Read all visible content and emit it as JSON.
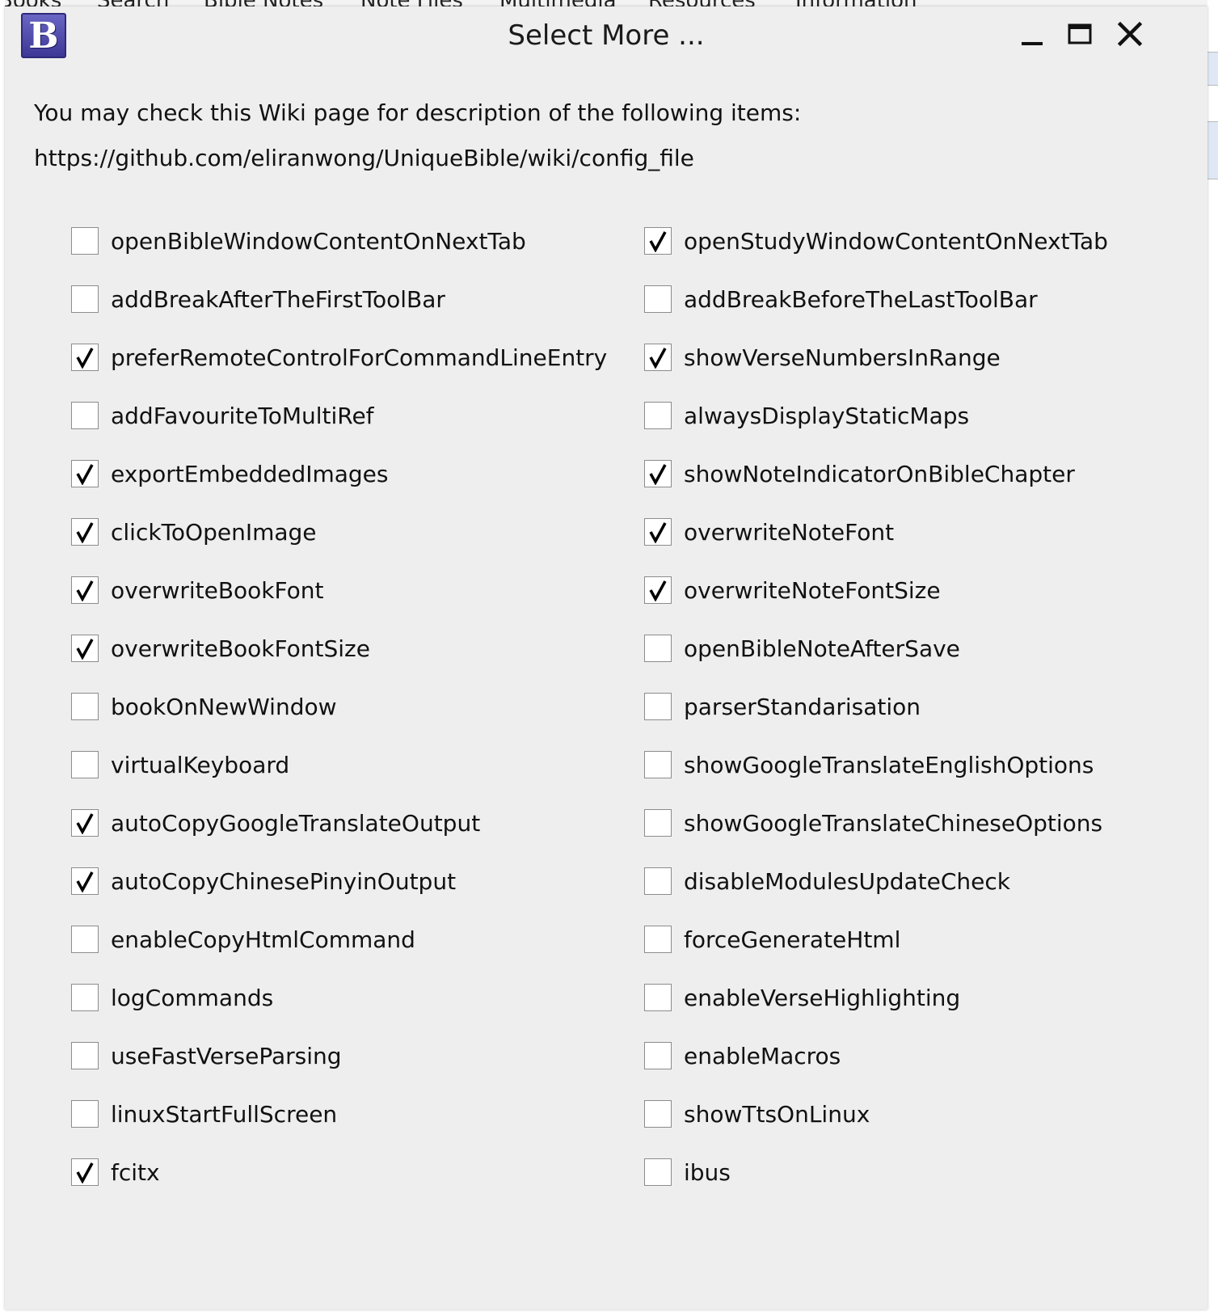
{
  "background": {
    "menu": [
      "Books",
      "Search",
      "Bible Notes",
      "Note Files",
      "Multimedia",
      "Resources",
      "Information"
    ]
  },
  "dialog": {
    "title": "Select More ...",
    "intro_line1": "You may check this Wiki page for description of the following items:",
    "intro_line2": "https://github.com/eliranwong/UniqueBible/wiki/config_file",
    "options_left": [
      {
        "label": "openBibleWindowContentOnNextTab",
        "checked": false
      },
      {
        "label": "addBreakAfterTheFirstToolBar",
        "checked": false
      },
      {
        "label": "preferRemoteControlForCommandLineEntry",
        "checked": true
      },
      {
        "label": "addFavouriteToMultiRef",
        "checked": false
      },
      {
        "label": "exportEmbeddedImages",
        "checked": true
      },
      {
        "label": "clickToOpenImage",
        "checked": true
      },
      {
        "label": "overwriteBookFont",
        "checked": true
      },
      {
        "label": "overwriteBookFontSize",
        "checked": true
      },
      {
        "label": "bookOnNewWindow",
        "checked": false
      },
      {
        "label": "virtualKeyboard",
        "checked": false
      },
      {
        "label": "autoCopyGoogleTranslateOutput",
        "checked": true
      },
      {
        "label": "autoCopyChinesePinyinOutput",
        "checked": true
      },
      {
        "label": "enableCopyHtmlCommand",
        "checked": false
      },
      {
        "label": "logCommands",
        "checked": false
      },
      {
        "label": "useFastVerseParsing",
        "checked": false
      },
      {
        "label": "linuxStartFullScreen",
        "checked": false
      },
      {
        "label": "fcitx",
        "checked": true
      }
    ],
    "options_right": [
      {
        "label": "openStudyWindowContentOnNextTab",
        "checked": true
      },
      {
        "label": "addBreakBeforeTheLastToolBar",
        "checked": false
      },
      {
        "label": "showVerseNumbersInRange",
        "checked": true
      },
      {
        "label": "alwaysDisplayStaticMaps",
        "checked": false
      },
      {
        "label": "showNoteIndicatorOnBibleChapter",
        "checked": true
      },
      {
        "label": "overwriteNoteFont",
        "checked": true
      },
      {
        "label": "overwriteNoteFontSize",
        "checked": true
      },
      {
        "label": "openBibleNoteAfterSave",
        "checked": false
      },
      {
        "label": "parserStandarisation",
        "checked": false
      },
      {
        "label": "showGoogleTranslateEnglishOptions",
        "checked": false
      },
      {
        "label": "showGoogleTranslateChineseOptions",
        "checked": false
      },
      {
        "label": "disableModulesUpdateCheck",
        "checked": false
      },
      {
        "label": "forceGenerateHtml",
        "checked": false
      },
      {
        "label": "enableVerseHighlighting",
        "checked": false
      },
      {
        "label": "enableMacros",
        "checked": false
      },
      {
        "label": "showTtsOnLinux",
        "checked": false
      },
      {
        "label": "ibus",
        "checked": false
      }
    ]
  }
}
